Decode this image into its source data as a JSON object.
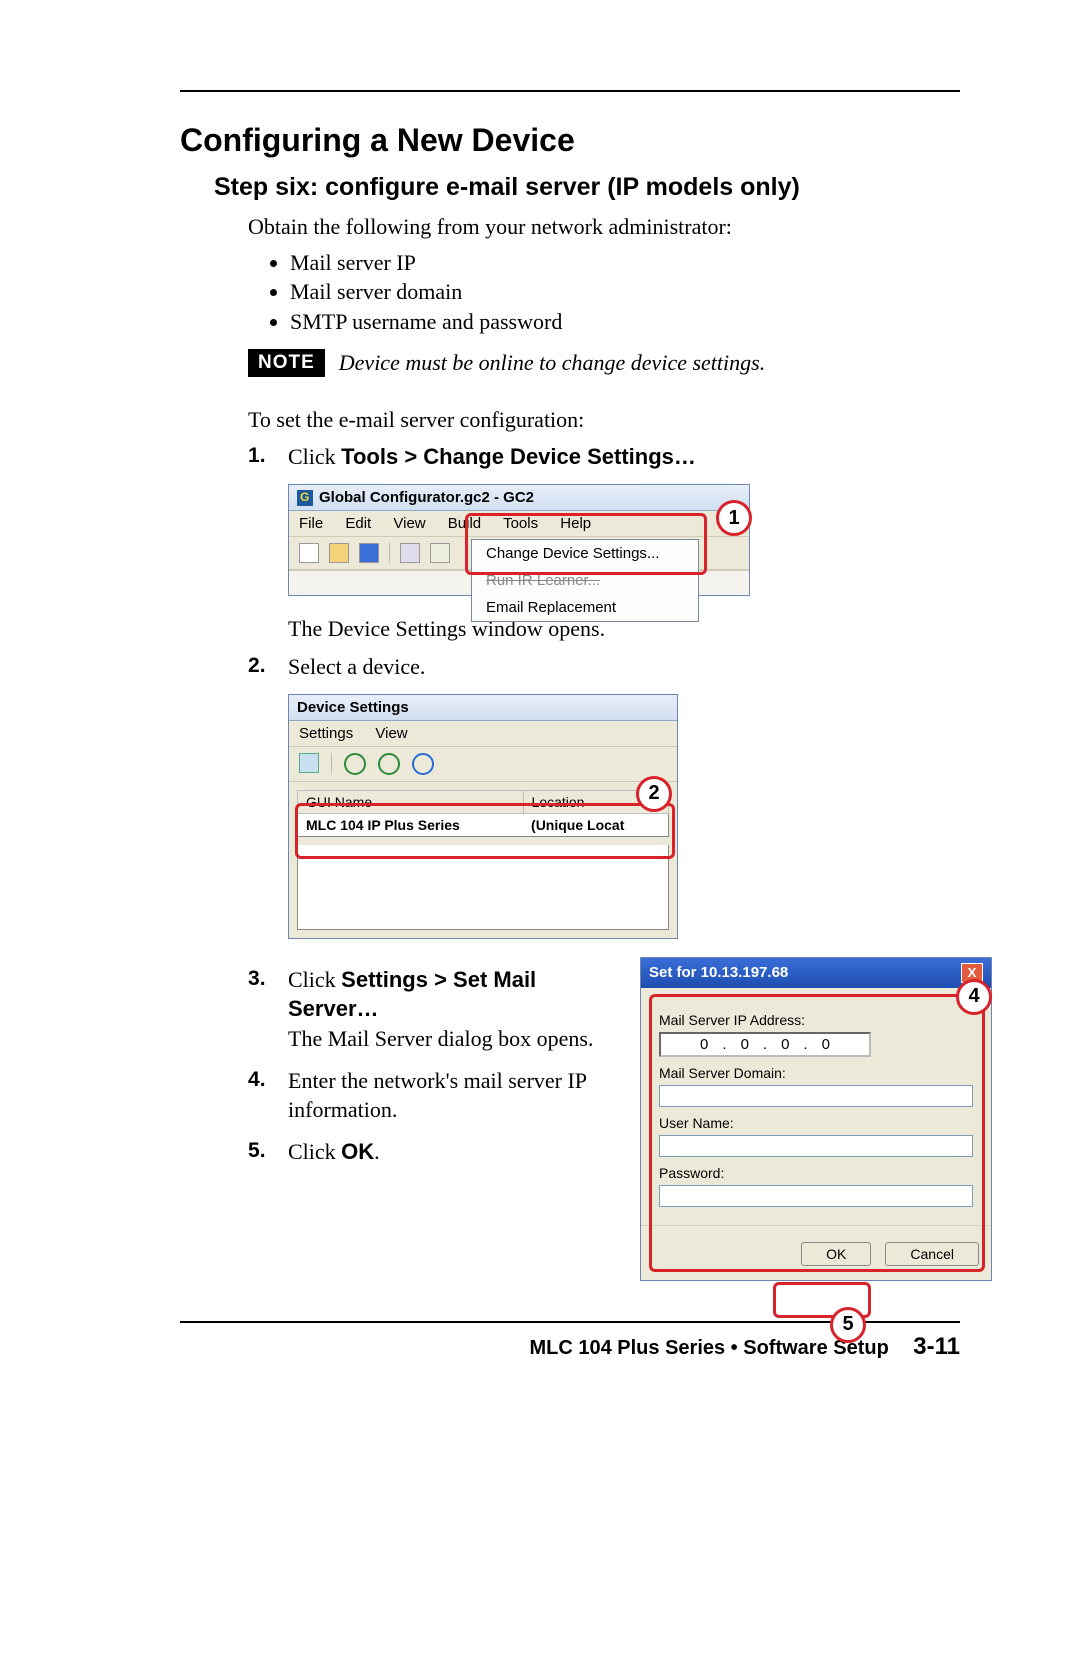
{
  "section_title": "Configuring a New Device",
  "step_title": "Step six: configure e-mail server (IP models only)",
  "intro_text": "Obtain the following from your network administrator:",
  "bullets": [
    "Mail server IP",
    "Mail server domain",
    "SMTP username and password"
  ],
  "note_label": "NOTE",
  "note_text": "Device must be online to change device settings.",
  "to_set_text": "To  set the e-mail server configuration:",
  "steps": {
    "s1_prefix": "Click ",
    "s1_bold": "Tools > Change Device Settings…",
    "s1_after": "The Device Settings window opens.",
    "s2": "Select a device.",
    "s3_prefix": "Click ",
    "s3_bold": "Settings > Set Mail Server…",
    "s3_after": "The Mail Server dialog box opens.",
    "s4": "Enter the network's mail server IP information.",
    "s5_prefix": "Click ",
    "s5_bold": "OK",
    "s5_suffix": "."
  },
  "screenshot1": {
    "title": "Global Configurator.gc2 - GC2",
    "menus": [
      "File",
      "Edit",
      "View",
      "Build",
      "Tools",
      "Help"
    ],
    "dropdown": [
      "Change Device Settings...",
      "Run IR Learner...",
      "Email Replacement"
    ]
  },
  "screenshot2": {
    "title": "Device Settings",
    "menus": [
      "Settings",
      "View"
    ],
    "col1": "GUI Name",
    "col2": "Location",
    "row1a": "MLC 104 IP Plus Series",
    "row1b": "(Unique Locat"
  },
  "screenshot3": {
    "title": "Set for 10.13.197.68",
    "label_ip": "Mail Server IP Address:",
    "ip": [
      "0",
      "0",
      "0",
      "0"
    ],
    "label_domain": "Mail Server Domain:",
    "label_user": "User Name:",
    "label_pass": "Password:",
    "btn_ok": "OK",
    "btn_cancel": "Cancel"
  },
  "callouts": {
    "c1": "1",
    "c2": "2",
    "c4": "4",
    "c5": "5"
  },
  "footer_text": "MLC 104 Plus Series • Software Setup",
  "footer_page": "3-11"
}
